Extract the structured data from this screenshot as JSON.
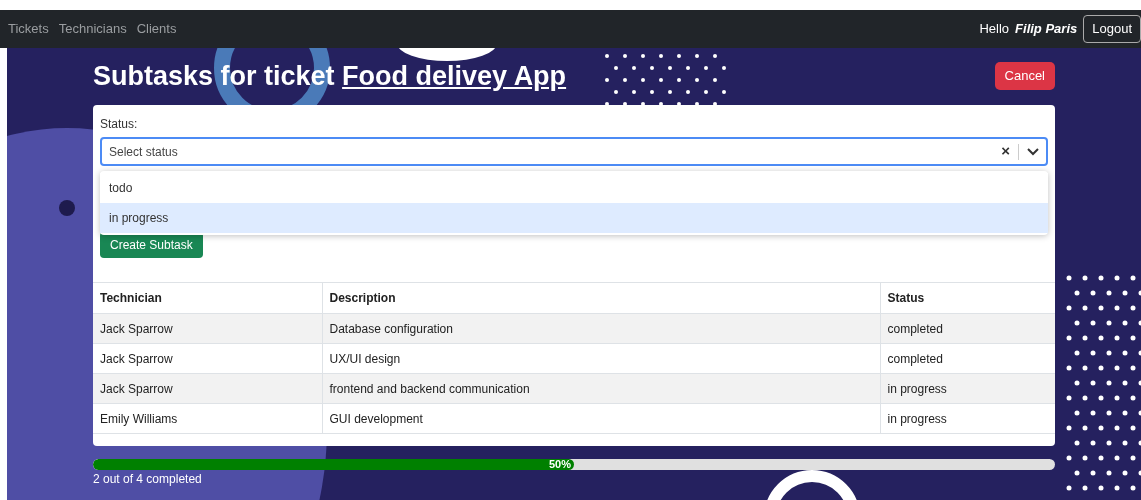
{
  "navbar": {
    "links": [
      "Tickets",
      "Technicians",
      "Clients"
    ],
    "greeting": "Hello",
    "user": "Filip Paris",
    "logout": "Logout"
  },
  "title": {
    "prefix": "Subtasks for ticket",
    "ticket": "Food delivey App"
  },
  "cancel": "Cancel",
  "form": {
    "status_label": "Status:",
    "status_select": {
      "placeholder": "Select status",
      "clear": "×",
      "options": [
        {
          "label": "todo",
          "selected": false
        },
        {
          "label": "in progress",
          "selected": true
        }
      ]
    },
    "create": "Create Subtask"
  },
  "table": {
    "columns": [
      "Technician",
      "Description",
      "Status"
    ],
    "rows": [
      [
        "Jack Sparrow",
        "Database configuration",
        "completed"
      ],
      [
        "Jack Sparrow",
        "UX/UI design",
        "completed"
      ],
      [
        "Jack Sparrow",
        "frontend and backend communication",
        "in progress"
      ],
      [
        "Emily Williams",
        "GUI development",
        "in progress"
      ]
    ]
  },
  "progress": {
    "level": 0.5,
    "reading": "50%",
    "caption": "2 out of 4 completed"
  }
}
